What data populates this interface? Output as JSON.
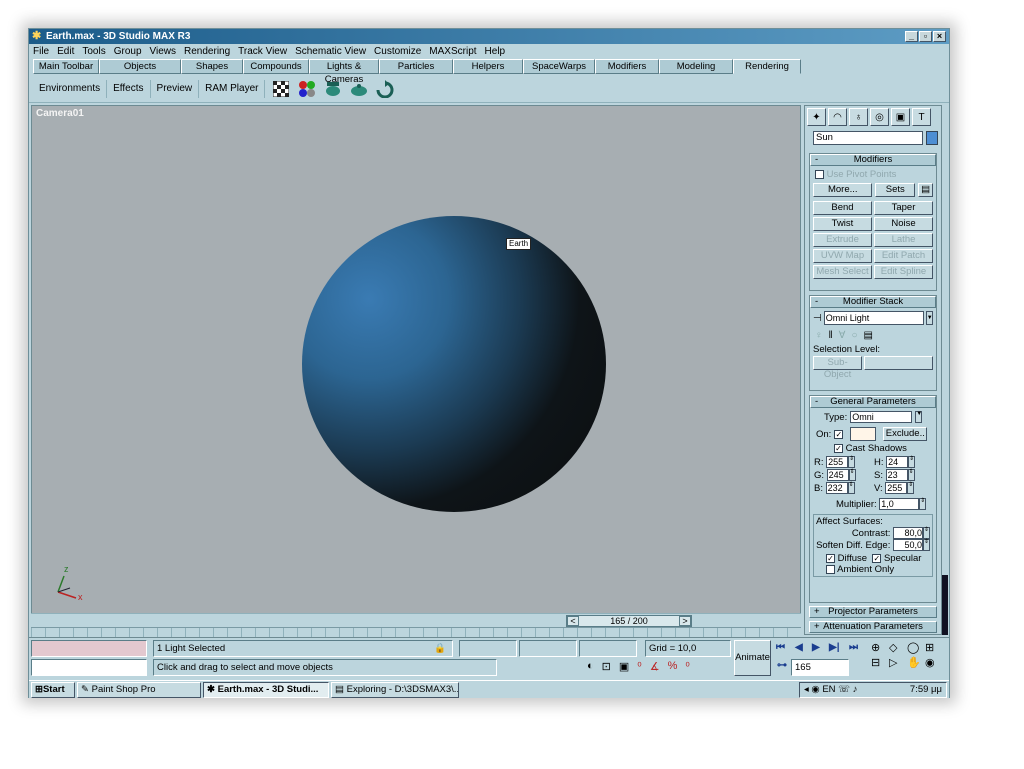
{
  "window": {
    "title": "Earth.max - 3D Studio MAX R3",
    "min": "_",
    "restore": "▫",
    "close": "×"
  },
  "menu": [
    "File",
    "Edit",
    "Tools",
    "Group",
    "Views",
    "Rendering",
    "Track View",
    "Schematic View",
    "Customize",
    "MAXScript",
    "Help"
  ],
  "tabs": [
    "Main Toolbar",
    "Objects",
    "Shapes",
    "Compounds",
    "Lights & Cameras",
    "Particles",
    "Helpers",
    "SpaceWarps",
    "Modifiers",
    "Modeling",
    "Rendering"
  ],
  "active_tab": "Rendering",
  "toolbar": {
    "environments": "Environments",
    "effects": "Effects",
    "preview": "Preview",
    "ram_player": "RAM Player"
  },
  "viewport": {
    "label": "Camera01",
    "object_tag": "Earth",
    "axis_z": "z",
    "axis_x": "x"
  },
  "timeslider": {
    "value": "165 / 200",
    "prev": "<",
    "next": ">"
  },
  "cmd": {
    "object_name": "Sun",
    "object_color": "#4d8ed3",
    "modifiers": {
      "title": "Modifiers",
      "use_pivot": "Use Pivot Points",
      "more": "More...",
      "sets": "Sets",
      "buttons": [
        "Bend",
        "Taper",
        "Twist",
        "Noise",
        "Extrude",
        "Lathe",
        "UVW Map",
        "Edit Patch",
        "Mesh Select",
        "Edit Spline"
      ]
    },
    "stack": {
      "title": "Modifier Stack",
      "value": "Omni Light",
      "selection_level": "Selection Level:",
      "sub_object": "Sub-Object"
    },
    "general": {
      "title": "General Parameters",
      "type_label": "Type:",
      "type_value": "Omni",
      "on_label": "On:",
      "exclude": "Exclude..",
      "cast_shadows": "Cast Shadows",
      "r_label": "R:",
      "r": "255",
      "g_label": "G:",
      "g": "245",
      "b_label": "B:",
      "b": "232",
      "h_label": "H:",
      "h": "24",
      "s_label": "S:",
      "s": "23",
      "v_label": "V:",
      "v": "255",
      "multiplier_label": "Multiplier:",
      "multiplier": "1,0",
      "affect_surfaces": "Affect Surfaces:",
      "contrast_label": "Contrast:",
      "contrast": "80,0",
      "soften_label": "Soften Diff. Edge:",
      "soften": "50,0",
      "diffuse": "Diffuse",
      "specular": "Specular",
      "ambient_only": "Ambient Only"
    },
    "projector": "Projector Parameters",
    "attenuation": "Attenuation Parameters"
  },
  "status": {
    "selected": "1 Light Selected",
    "prompt": "Click and drag to select and move objects",
    "grid": "Grid = 10,0",
    "animate": "Animate",
    "frame": "165"
  },
  "taskbar": {
    "start": "Start",
    "tasks": [
      "Paint Shop Pro",
      "Earth.max - 3D Studi...",
      "Exploring - D:\\3DSMAX3\\..."
    ],
    "clock": "7:59 μμ",
    "tray_icons": "EN"
  },
  "colors": {
    "accent": "#1c5c8a",
    "panel": "#bcd5dd",
    "viewport_bg": "#a7aeb2",
    "sphere_light": "#3a7bb3",
    "status_pink": "#e3c8cf"
  }
}
